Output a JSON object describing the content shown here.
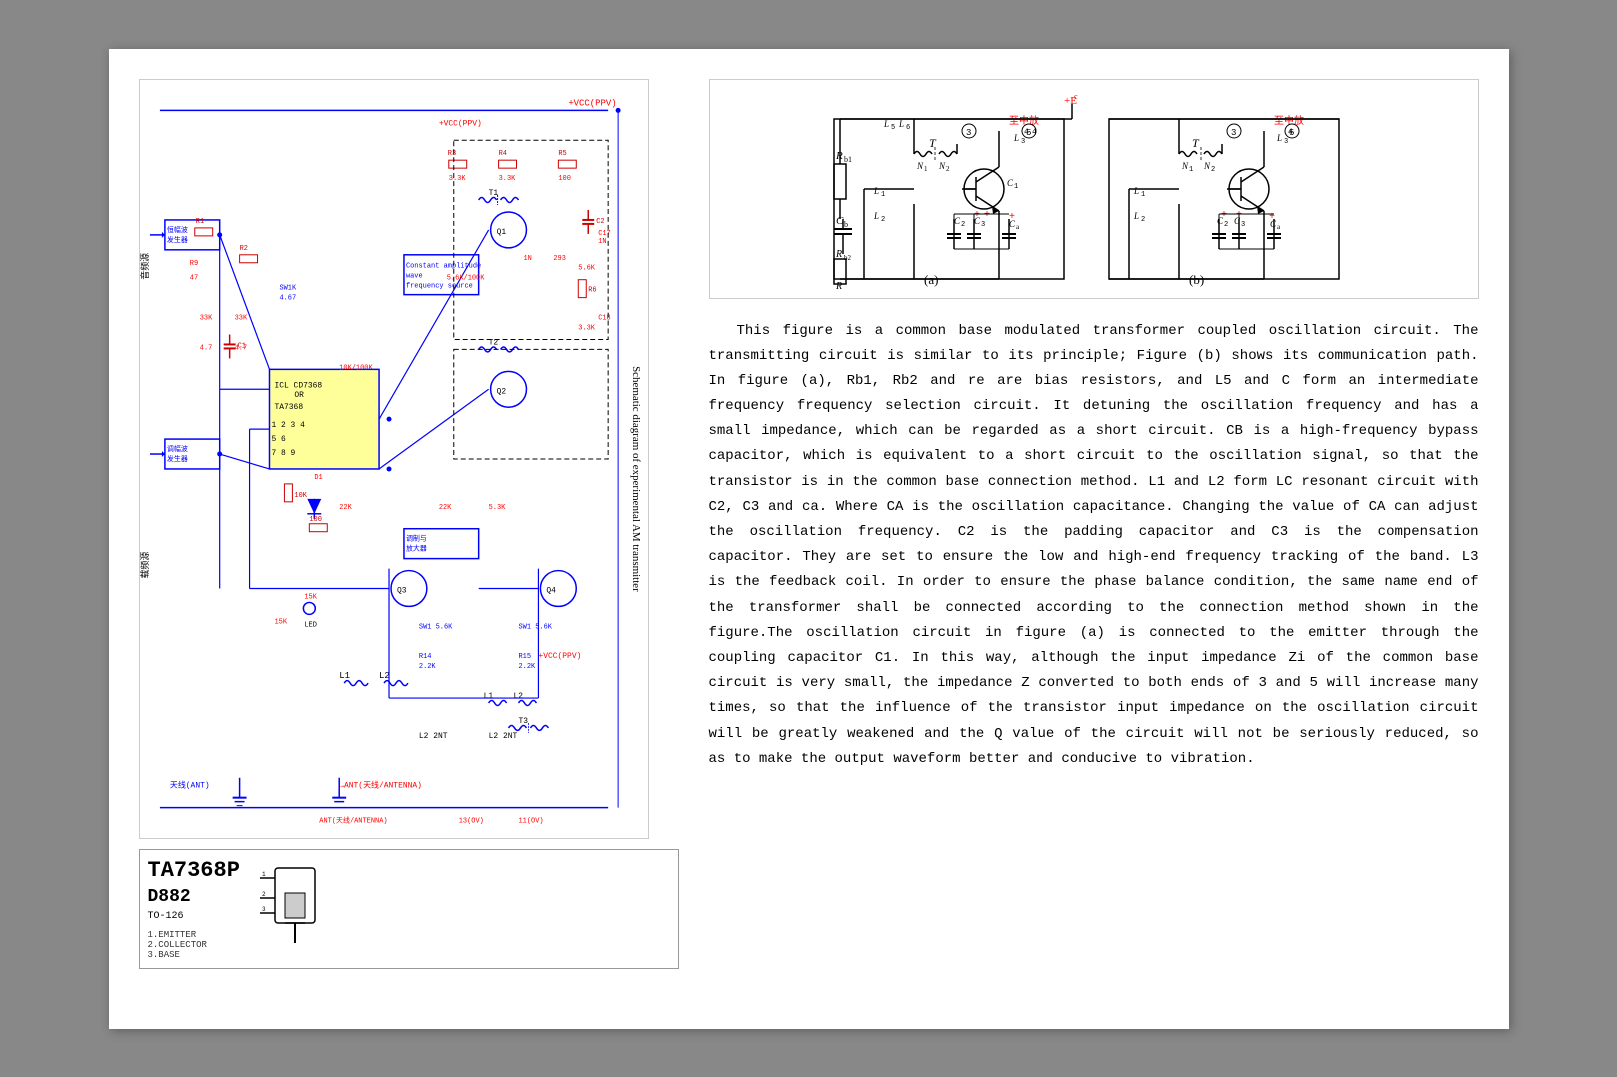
{
  "left": {
    "component1": {
      "name": "TA7368P",
      "subtitle": "D882"
    },
    "component2_label": "TO-126",
    "features": [
      "1.EMITTER",
      "2.COLLECTOR",
      "3.BASE"
    ]
  },
  "right": {
    "circuit_label_a": "(a)",
    "circuit_label_b": "(b)",
    "ec_label": "+Ec",
    "schematic_title": "Schematic diagram of experimental AM transmitter",
    "description": "This figure is a common base modulated transformer coupled oscillation circuit. The transmitting circuit is similar to its principle; Figure (b) shows its communication path. In figure (a), Rb1, Rb2 and re are bias resistors, and L5 and C form an intermediate frequency frequency selection circuit. It detuning the oscillation frequency and has a small impedance, which can be regarded as a short circuit. CB is a high-frequency bypass capacitor, which is equivalent to a short circuit to the oscillation signal, so that the transistor is in the common base connection method. L1 and L2 form LC resonant circuit with C2, C3 and ca. Where CA is the oscillation capacitance. Changing the value of CA can adjust the oscillation frequency. C2 is the padding capacitor and C3 is the compensation capacitor. They are set to ensure the low and high-end frequency tracking of the band. L3 is the feedback coil. In order to ensure the phase balance condition, the same name end of the transformer shall be connected according to the connection method shown in the figure.The oscillation circuit in figure (a) is connected to the emitter through the coupling capacitor C1. In this way, although the input impedance Zi of the common base circuit is very small, the impedance Z converted to both ends of 3 and 5 will increase many times, so that the influence of the transistor input impedance on the oscillation circuit will be greatly weakened and the Q value of the circuit will not be seriously reduced, so as to make the output waveform better and conducive to vibration."
  }
}
